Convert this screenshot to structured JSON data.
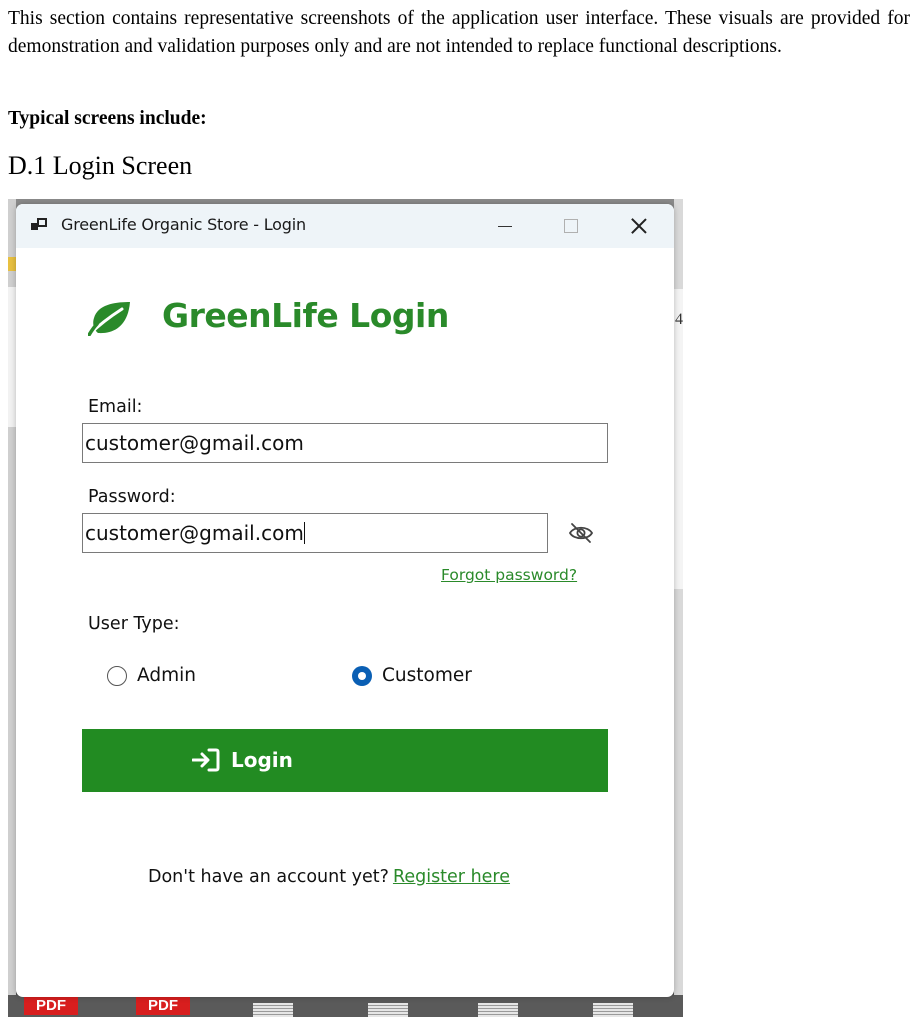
{
  "document": {
    "intro": "This section contains representative screenshots of the application user interface. These visuals are provided for demonstration and validation purposes only and are not intended to replace functional descriptions.",
    "subheading": "Typical screens include:",
    "heading": "D.1 Login Screen"
  },
  "screenshot": {
    "background": {
      "right_digit": "4",
      "taskbar_badges": [
        "PDF",
        "PDF"
      ]
    },
    "window": {
      "title": "GreenLife Organic Store - Login",
      "brand_title": "GreenLife Login",
      "email_label": "Email:",
      "email_value": "customer@gmail.com",
      "password_label": "Password:",
      "password_value": "customer@gmail.com",
      "forgot_link": "Forgot password?",
      "user_type_label": "User Type:",
      "user_type_options": [
        "Admin",
        "Customer"
      ],
      "user_type_selected": "Customer",
      "login_button": "Login",
      "register_prompt": "Don't have an account yet?",
      "register_link": "Register here"
    }
  },
  "icons": {
    "app": "app-window-icon",
    "brand": "leaf-icon",
    "password_toggle": "eye-slash-icon",
    "login": "sign-in-icon"
  },
  "colors": {
    "brand_green": "#2a8a2a",
    "button_green": "#228b22",
    "radio_selected": "#0a5fb4",
    "titlebar": "#eef4f8"
  }
}
